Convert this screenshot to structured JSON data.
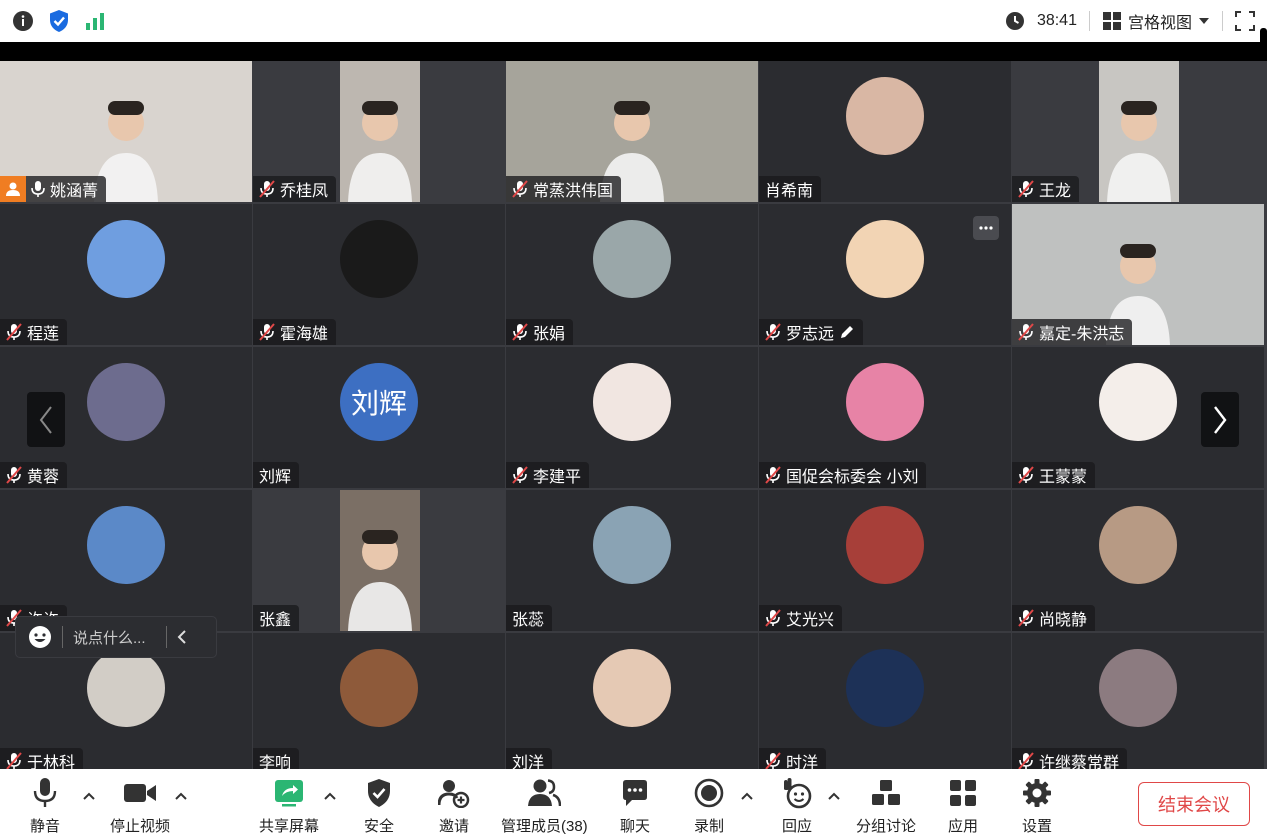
{
  "topbar": {
    "timer": "38:41",
    "view_mode": "宫格视图"
  },
  "participants": [
    {
      "name": "姚涵菁",
      "muted": false,
      "host": true,
      "type": "video",
      "bg": "#d9d4cf"
    },
    {
      "name": "乔桂凤",
      "muted": true,
      "type": "video",
      "bg": "#bdb7b0"
    },
    {
      "name": "常蒸洪伟国",
      "muted": true,
      "type": "video",
      "bg": "#a6a49b"
    },
    {
      "name": "肖希南",
      "muted": false,
      "type": "avatar",
      "bg": "#d9b7a4"
    },
    {
      "name": "王龙",
      "muted": true,
      "type": "video",
      "bg": "#c8c6c2"
    },
    {
      "name": "程莲",
      "muted": true,
      "type": "avatar",
      "bg": "#6f9ee0"
    },
    {
      "name": "霍海雄",
      "muted": true,
      "type": "avatar",
      "bg": "#1a1a1a"
    },
    {
      "name": "张娟",
      "muted": true,
      "type": "avatar",
      "bg": "#9aa7a9"
    },
    {
      "name": "罗志远",
      "muted": true,
      "type": "avatar",
      "bg": "#f2d4b4",
      "editing": true
    },
    {
      "name": "嘉定-朱洪志",
      "muted": true,
      "type": "video",
      "bg": "#bfc1c0"
    },
    {
      "name": "黄蓉",
      "muted": true,
      "type": "avatar",
      "bg": "#6d6c8e"
    },
    {
      "name": "刘辉",
      "muted": false,
      "type": "text",
      "avatar_text": "刘辉",
      "bg": "#3d6fc2"
    },
    {
      "name": "李建平",
      "muted": true,
      "type": "avatar",
      "bg": "#f1e6e1"
    },
    {
      "name": "国促会标委会 小刘",
      "muted": true,
      "type": "avatar",
      "bg": "#e783a6"
    },
    {
      "name": "王蒙蒙",
      "muted": true,
      "type": "avatar",
      "bg": "#f4eeea"
    },
    {
      "name": "许许",
      "muted": true,
      "type": "avatar",
      "bg": "#5b89c8"
    },
    {
      "name": "张鑫",
      "muted": false,
      "type": "video",
      "bg": "#7b6f65"
    },
    {
      "name": "张蕊",
      "muted": false,
      "type": "avatar",
      "bg": "#8aa3b4"
    },
    {
      "name": "艾光兴",
      "muted": true,
      "type": "avatar",
      "bg": "#a73f39"
    },
    {
      "name": "尚晓静",
      "muted": true,
      "type": "avatar",
      "bg": "#b79a84"
    },
    {
      "name": "于林科",
      "muted": true,
      "type": "avatar",
      "bg": "#d2cdc6"
    },
    {
      "name": "李响",
      "muted": false,
      "type": "avatar",
      "bg": "#8e5a3a"
    },
    {
      "name": "刘洋",
      "muted": false,
      "type": "avatar",
      "bg": "#e5c9b4"
    },
    {
      "name": "时洋",
      "muted": true,
      "type": "avatar",
      "bg": "#1d3157"
    },
    {
      "name": "许继蔡常群",
      "muted": true,
      "type": "avatar",
      "bg": "#8c7b80"
    }
  ],
  "chat": {
    "placeholder": "说点什么..."
  },
  "toolbar": {
    "mute": "静音",
    "stop_video": "停止视频",
    "share_screen": "共享屏幕",
    "security": "安全",
    "invite": "邀请",
    "manage_members": "管理成员(38)",
    "chat": "聊天",
    "record": "录制",
    "react": "回应",
    "breakout": "分组讨论",
    "apps": "应用",
    "settings": "设置",
    "end_meeting": "结束会议"
  },
  "colors": {
    "accent_green": "#2bb673",
    "end_red": "#e04848",
    "host_orange": "#f07d22",
    "security_blue": "#1a6be0"
  }
}
